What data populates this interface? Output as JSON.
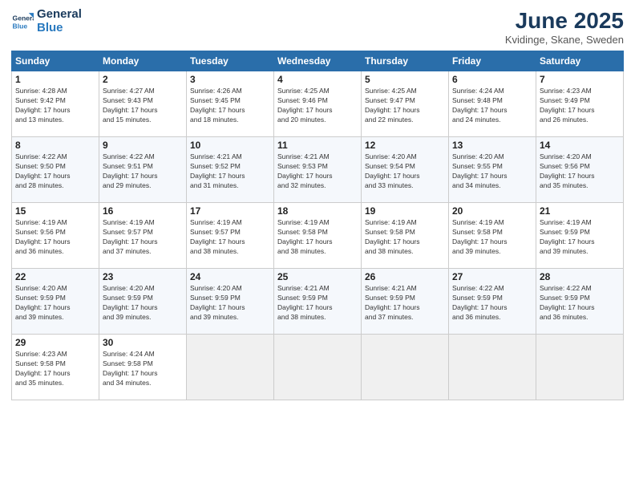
{
  "logo": {
    "line1": "General",
    "line2": "Blue"
  },
  "title": "June 2025",
  "subtitle": "Kvidinge, Skane, Sweden",
  "days_header": [
    "Sunday",
    "Monday",
    "Tuesday",
    "Wednesday",
    "Thursday",
    "Friday",
    "Saturday"
  ],
  "weeks": [
    [
      {
        "day": "1",
        "info": "Sunrise: 4:28 AM\nSunset: 9:42 PM\nDaylight: 17 hours\nand 13 minutes."
      },
      {
        "day": "2",
        "info": "Sunrise: 4:27 AM\nSunset: 9:43 PM\nDaylight: 17 hours\nand 15 minutes."
      },
      {
        "day": "3",
        "info": "Sunrise: 4:26 AM\nSunset: 9:45 PM\nDaylight: 17 hours\nand 18 minutes."
      },
      {
        "day": "4",
        "info": "Sunrise: 4:25 AM\nSunset: 9:46 PM\nDaylight: 17 hours\nand 20 minutes."
      },
      {
        "day": "5",
        "info": "Sunrise: 4:25 AM\nSunset: 9:47 PM\nDaylight: 17 hours\nand 22 minutes."
      },
      {
        "day": "6",
        "info": "Sunrise: 4:24 AM\nSunset: 9:48 PM\nDaylight: 17 hours\nand 24 minutes."
      },
      {
        "day": "7",
        "info": "Sunrise: 4:23 AM\nSunset: 9:49 PM\nDaylight: 17 hours\nand 26 minutes."
      }
    ],
    [
      {
        "day": "8",
        "info": "Sunrise: 4:22 AM\nSunset: 9:50 PM\nDaylight: 17 hours\nand 28 minutes."
      },
      {
        "day": "9",
        "info": "Sunrise: 4:22 AM\nSunset: 9:51 PM\nDaylight: 17 hours\nand 29 minutes."
      },
      {
        "day": "10",
        "info": "Sunrise: 4:21 AM\nSunset: 9:52 PM\nDaylight: 17 hours\nand 31 minutes."
      },
      {
        "day": "11",
        "info": "Sunrise: 4:21 AM\nSunset: 9:53 PM\nDaylight: 17 hours\nand 32 minutes."
      },
      {
        "day": "12",
        "info": "Sunrise: 4:20 AM\nSunset: 9:54 PM\nDaylight: 17 hours\nand 33 minutes."
      },
      {
        "day": "13",
        "info": "Sunrise: 4:20 AM\nSunset: 9:55 PM\nDaylight: 17 hours\nand 34 minutes."
      },
      {
        "day": "14",
        "info": "Sunrise: 4:20 AM\nSunset: 9:56 PM\nDaylight: 17 hours\nand 35 minutes."
      }
    ],
    [
      {
        "day": "15",
        "info": "Sunrise: 4:19 AM\nSunset: 9:56 PM\nDaylight: 17 hours\nand 36 minutes."
      },
      {
        "day": "16",
        "info": "Sunrise: 4:19 AM\nSunset: 9:57 PM\nDaylight: 17 hours\nand 37 minutes."
      },
      {
        "day": "17",
        "info": "Sunrise: 4:19 AM\nSunset: 9:57 PM\nDaylight: 17 hours\nand 38 minutes."
      },
      {
        "day": "18",
        "info": "Sunrise: 4:19 AM\nSunset: 9:58 PM\nDaylight: 17 hours\nand 38 minutes."
      },
      {
        "day": "19",
        "info": "Sunrise: 4:19 AM\nSunset: 9:58 PM\nDaylight: 17 hours\nand 38 minutes."
      },
      {
        "day": "20",
        "info": "Sunrise: 4:19 AM\nSunset: 9:58 PM\nDaylight: 17 hours\nand 39 minutes."
      },
      {
        "day": "21",
        "info": "Sunrise: 4:19 AM\nSunset: 9:59 PM\nDaylight: 17 hours\nand 39 minutes."
      }
    ],
    [
      {
        "day": "22",
        "info": "Sunrise: 4:20 AM\nSunset: 9:59 PM\nDaylight: 17 hours\nand 39 minutes."
      },
      {
        "day": "23",
        "info": "Sunrise: 4:20 AM\nSunset: 9:59 PM\nDaylight: 17 hours\nand 39 minutes."
      },
      {
        "day": "24",
        "info": "Sunrise: 4:20 AM\nSunset: 9:59 PM\nDaylight: 17 hours\nand 39 minutes."
      },
      {
        "day": "25",
        "info": "Sunrise: 4:21 AM\nSunset: 9:59 PM\nDaylight: 17 hours\nand 38 minutes."
      },
      {
        "day": "26",
        "info": "Sunrise: 4:21 AM\nSunset: 9:59 PM\nDaylight: 17 hours\nand 37 minutes."
      },
      {
        "day": "27",
        "info": "Sunrise: 4:22 AM\nSunset: 9:59 PM\nDaylight: 17 hours\nand 36 minutes."
      },
      {
        "day": "28",
        "info": "Sunrise: 4:22 AM\nSunset: 9:59 PM\nDaylight: 17 hours\nand 36 minutes."
      }
    ],
    [
      {
        "day": "29",
        "info": "Sunrise: 4:23 AM\nSunset: 9:58 PM\nDaylight: 17 hours\nand 35 minutes."
      },
      {
        "day": "30",
        "info": "Sunrise: 4:24 AM\nSunset: 9:58 PM\nDaylight: 17 hours\nand 34 minutes."
      },
      {
        "day": "",
        "info": ""
      },
      {
        "day": "",
        "info": ""
      },
      {
        "day": "",
        "info": ""
      },
      {
        "day": "",
        "info": ""
      },
      {
        "day": "",
        "info": ""
      }
    ]
  ]
}
